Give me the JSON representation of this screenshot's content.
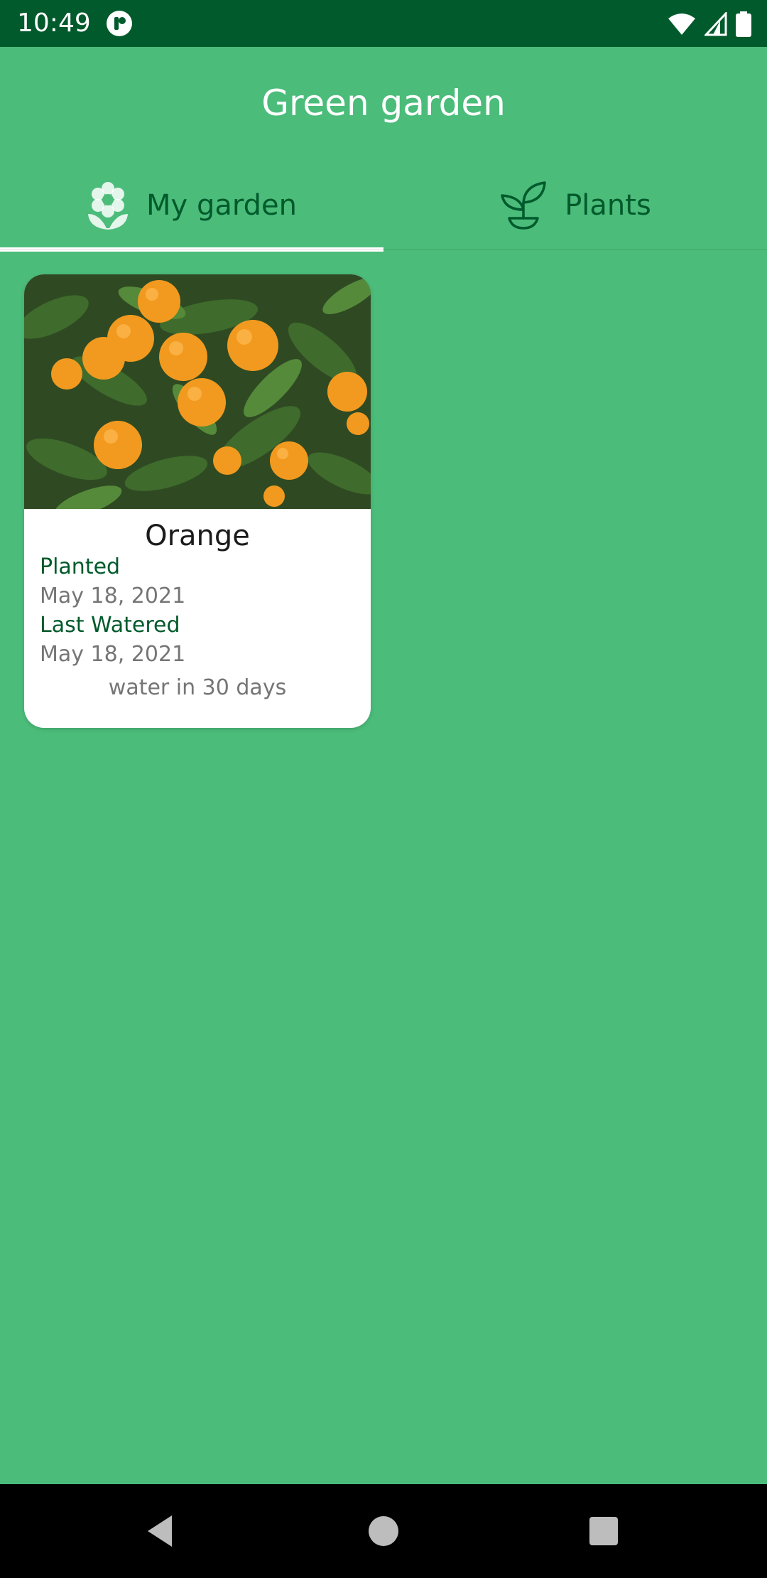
{
  "status_bar": {
    "time": "10:49"
  },
  "app_bar": {
    "title": "Green garden"
  },
  "tabs": [
    {
      "label": "My garden",
      "icon": "flower-icon",
      "selected": true
    },
    {
      "label": "Plants",
      "icon": "sprout-icon",
      "selected": false
    }
  ],
  "garden": {
    "plants": [
      {
        "name": "Orange",
        "planted_label": "Planted",
        "planted_date": "May 18, 2021",
        "watered_label": "Last Watered",
        "watered_date": "May 18, 2021",
        "water_hint": "water in 30 days"
      }
    ]
  },
  "colors": {
    "background": "#4bbc7a",
    "status_bar": "#005a2b",
    "accent_text": "#005a2b",
    "secondary_text": "#757575"
  }
}
